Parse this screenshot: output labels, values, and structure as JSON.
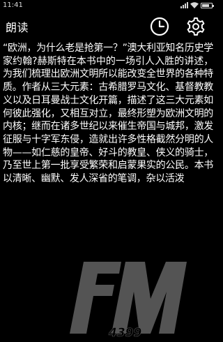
{
  "status_bar": {
    "time": "11:41",
    "battery_level": 0.8,
    "signal_bars": 4
  },
  "header": {
    "title": "朗读",
    "icons": [
      "clock-icon",
      "gear-icon"
    ]
  },
  "content": {
    "text": "“欧洲，为什么老是抢第一？”澳大利亚知名历史学家约翰?赫斯特在本书中的一场引人入胜的讲述，为我们梳理出欧洲文明所以能改变全世界的各种特质。作者从三大元素：古希腊罗马文化、基督教教义以及日耳曼战士文化开篇，描述了这三大元素如何彼此强化，又相互对立，最终形塑为欧洲文明的内核；继而在诸多世纪以来催生帝国与城邦，激发征服与十字军东侵，造就出许多性格截然分明的人物——如仁慈的皇帝、好斗的教皇、侠义的骑士，乃至世上第一批享受繁荣和启蒙果实的公民。本书以清晰、幽默、发人深省的笔调，杂以活泼"
  },
  "watermark": {
    "logo_text": "FM",
    "sub_text": "4399"
  },
  "colors": {
    "background": "#000000",
    "text": "#ffffff",
    "status_text": "#d8d8d8",
    "watermark": "#9a9a9a"
  }
}
